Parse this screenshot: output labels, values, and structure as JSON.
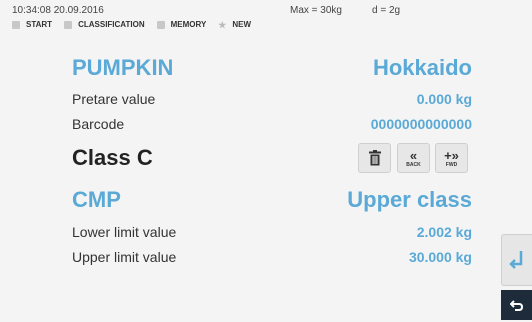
{
  "status": {
    "time": "10:34:08 20.09.2016",
    "max": "Max = 30kg",
    "division": "d = 2g"
  },
  "nav": [
    {
      "label": "START",
      "icon": "scale-icon"
    },
    {
      "label": "CLASSIFICATION",
      "icon": "classification-icon"
    },
    {
      "label": "MEMORY",
      "icon": "memory-icon"
    },
    {
      "label": "NEW",
      "icon": "star-icon"
    }
  ],
  "product": {
    "name": "PUMPKIN",
    "variety": "Hokkaido"
  },
  "pretare": {
    "label": "Pretare value",
    "value": "0.000 kg"
  },
  "barcode": {
    "label": "Barcode",
    "value": "0000000000000"
  },
  "class_label": "Class C",
  "buttons": {
    "back": "BACK",
    "fwd": "FWD"
  },
  "cmp": {
    "label": "CMP",
    "value": "Upper class"
  },
  "lower": {
    "label": "Lower limit value",
    "value": "2.002 kg"
  },
  "upper": {
    "label": "Upper limit value",
    "value": "30.000 kg"
  },
  "colors": {
    "accent": "#5aa9d6",
    "dark": "#1d2b3a"
  }
}
